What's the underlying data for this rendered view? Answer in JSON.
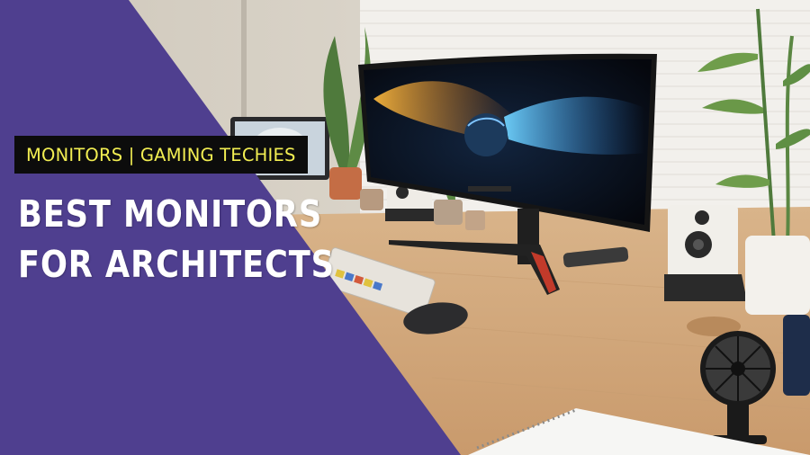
{
  "category_tag": "MONITORS | GAMING TECHIES",
  "headline": {
    "line1": "BEST MONITORS",
    "line2": "FOR ARCHITECTS"
  },
  "colors": {
    "overlay_purple": "#4f3f8f",
    "tag_background": "#0c0c0c",
    "tag_text": "#f2ee52",
    "headline_text": "#ffffff"
  },
  "photo_elements": [
    "ultrawide-curved-monitor",
    "laptop",
    "desk-speakers",
    "potted-plants",
    "keyboard",
    "mouse",
    "desk-fan",
    "notepad"
  ]
}
